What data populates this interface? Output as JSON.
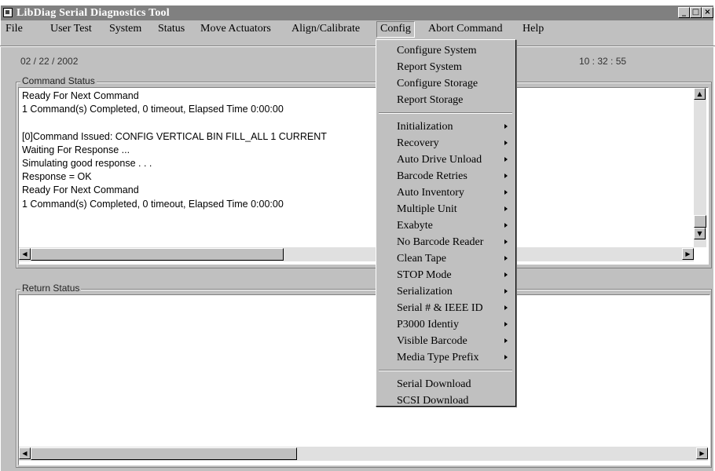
{
  "window": {
    "title": "LibDiag Serial Diagnostics Tool"
  },
  "window_buttons": {
    "minimize": "_",
    "maximize": "□",
    "close": "×"
  },
  "menu": {
    "file": "File",
    "user_test": "User Test",
    "system": "System",
    "status": "Status",
    "move_actuators": "Move Actuators",
    "align_calibrate": "Align/Calibrate",
    "config": "Config",
    "abort_command": "Abort Command",
    "help": "Help"
  },
  "header": {
    "date": "02 / 22 / 2002",
    "time": "10 : 32 : 55"
  },
  "command_status": {
    "label": "Command Status",
    "lines": [
      "Ready For Next Command",
      "1 Command(s) Completed, 0 timeout, Elapsed Time 0:00:00",
      "",
      "[0]Command Issued: CONFIG VERTICAL BIN FILL_ALL 1 CURRENT",
      "Waiting For Response ...",
      "Simulating good response . . .",
      "Response = OK",
      "Ready For Next Command",
      "1 Command(s) Completed, 0 timeout, Elapsed Time 0:00:00"
    ]
  },
  "return_status": {
    "label": "Return Status"
  },
  "config_menu": {
    "group1": [
      "Configure System",
      "Report System",
      "Configure Storage",
      "Report Storage"
    ],
    "group2": [
      "Initialization",
      "Recovery",
      "Auto Drive Unload",
      "Barcode Retries",
      "Auto Inventory",
      "Multiple Unit",
      "Exabyte",
      "No Barcode Reader",
      "Clean Tape",
      "STOP Mode",
      "Serialization",
      "Serial # & IEEE ID",
      "P3000 Identiy",
      "Visible Barcode",
      "Media Type Prefix"
    ],
    "group3": [
      "Serial Download",
      "SCSI Download"
    ]
  },
  "scrollbar_glyphs": {
    "up": "▲",
    "down": "▼",
    "left": "◀",
    "right": "▶"
  }
}
